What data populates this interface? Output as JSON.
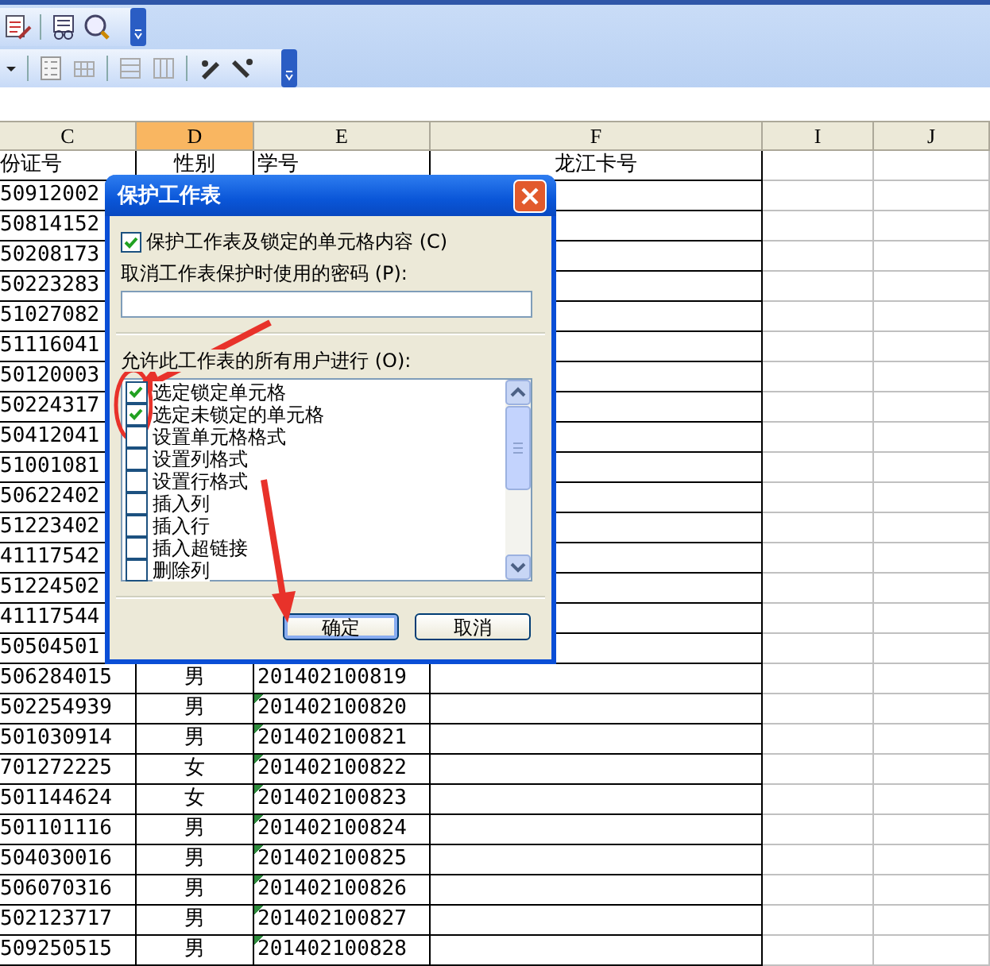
{
  "columns": [
    {
      "label": "C",
      "selected": false
    },
    {
      "label": "D",
      "selected": true
    },
    {
      "label": "E",
      "selected": false
    },
    {
      "label": "F",
      "selected": false
    },
    {
      "label": "I",
      "selected": false
    },
    {
      "label": "J",
      "selected": false
    }
  ],
  "header_row": {
    "c": "份证号",
    "d": "性别",
    "e": "学号",
    "f": "龙江卡号"
  },
  "rows": [
    {
      "c": "50912002"
    },
    {
      "c": "50814152"
    },
    {
      "c": "50208173"
    },
    {
      "c": "50223283"
    },
    {
      "c": "51027082"
    },
    {
      "c": "51116041"
    },
    {
      "c": "50120003"
    },
    {
      "c": "50224317"
    },
    {
      "c": "50412041"
    },
    {
      "c": "51001081"
    },
    {
      "c": "50622402"
    },
    {
      "c": "51223402"
    },
    {
      "c": "41117542"
    },
    {
      "c": "51224502"
    },
    {
      "c": "41117544"
    },
    {
      "c": "50504501"
    },
    {
      "c": "506284015",
      "d": "男",
      "e": "201402100819"
    },
    {
      "c": "502254939",
      "d": "男",
      "e": "201402100820",
      "text_flag": true
    },
    {
      "c": "501030914",
      "d": "男",
      "e": "201402100821",
      "text_flag": true
    },
    {
      "c": "701272225",
      "d": "女",
      "e": "201402100822",
      "text_flag": true
    },
    {
      "c": "501144624",
      "d": "女",
      "e": "201402100823",
      "text_flag": true
    },
    {
      "c": "501101116",
      "d": "男",
      "e": "201402100824",
      "text_flag": true
    },
    {
      "c": "504030016",
      "d": "男",
      "e": "201402100825",
      "text_flag": true
    },
    {
      "c": "506070316",
      "d": "男",
      "e": "201402100826",
      "text_flag": true
    },
    {
      "c": "502123717",
      "d": "男",
      "e": "201402100827",
      "text_flag": true
    },
    {
      "c": "509250515",
      "d": "男",
      "e": "201402100828",
      "text_flag": true
    }
  ],
  "dialog": {
    "title": "保护工作表",
    "protect_checkbox": {
      "label": "保护工作表及锁定的单元格内容 (C)",
      "checked": true
    },
    "password_label": "取消工作表保护时使用的密码 (P):",
    "permissions_label": "允许此工作表的所有用户进行 (O):",
    "permissions": [
      {
        "label": "选定锁定单元格",
        "checked": true
      },
      {
        "label": "选定未锁定的单元格",
        "checked": true
      },
      {
        "label": "设置单元格格式",
        "checked": false
      },
      {
        "label": "设置列格式",
        "checked": false
      },
      {
        "label": "设置行格式",
        "checked": false
      },
      {
        "label": "插入列",
        "checked": false
      },
      {
        "label": "插入行",
        "checked": false
      },
      {
        "label": "插入超链接",
        "checked": false
      },
      {
        "label": "删除列",
        "checked": false
      }
    ],
    "buttons": [
      {
        "label": "确定",
        "default": true
      },
      {
        "label": "取消",
        "default": false
      }
    ]
  }
}
